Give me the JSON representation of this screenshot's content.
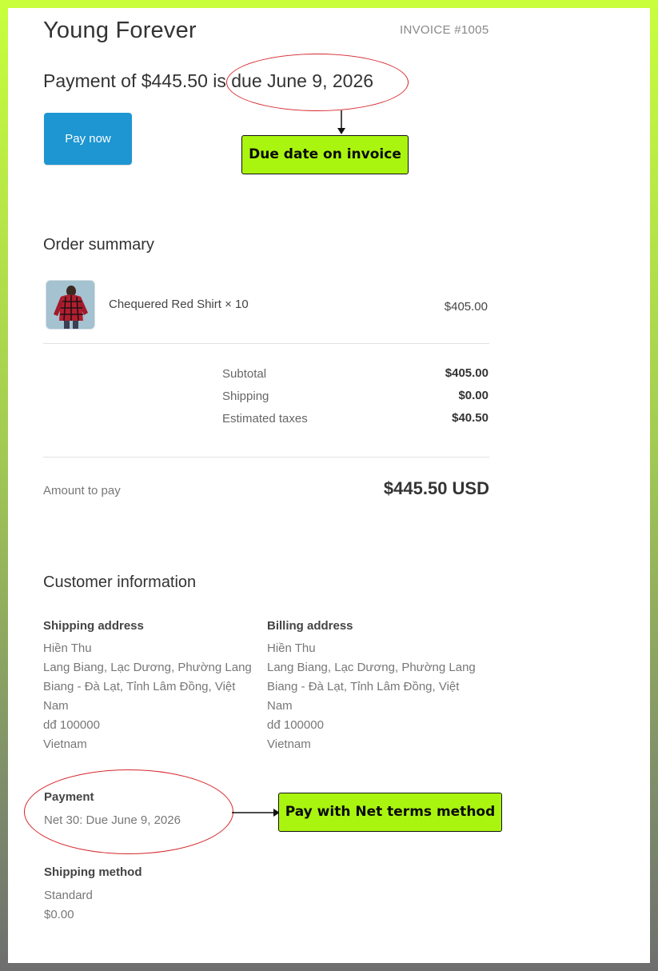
{
  "header": {
    "store_name": "Young Forever",
    "invoice_number": "INVOICE #1005"
  },
  "payment_banner": {
    "prefix": "Payment of $445.50 is ",
    "due_text": "due June 9, 2026",
    "pay_button_label": "Pay now"
  },
  "order_summary": {
    "title": "Order summary",
    "item": {
      "name": "Chequered Red Shirt × 10",
      "price": "$405.00"
    },
    "totals": [
      {
        "label": "Subtotal",
        "value": "$405.00"
      },
      {
        "label": "Shipping",
        "value": "$0.00"
      },
      {
        "label": "Estimated taxes",
        "value": "$40.50"
      }
    ],
    "amount_label": "Amount to pay",
    "amount_value": "$445.50 USD"
  },
  "customer_info": {
    "title": "Customer information",
    "shipping_address": {
      "title": "Shipping address",
      "name": "Hiền Thu",
      "line1": "Lang Biang, Lạc Dương, Phường Lang Biang - Đà Lạt, Tỉnh Lâm Đồng, Việt Nam",
      "postal": "dđ 100000",
      "country": "Vietnam"
    },
    "billing_address": {
      "title": "Billing address",
      "name": "Hiền Thu",
      "line1": "Lang Biang, Lạc Dương, Phường Lang Biang - Đà Lạt, Tỉnh Lâm Đồng, Việt Nam",
      "postal": "dđ 100000",
      "country": "Vietnam"
    },
    "payment": {
      "title": "Payment",
      "value": "Net 30: Due June 9, 2026"
    },
    "shipping_method": {
      "title": "Shipping method",
      "name": "Standard",
      "price": "$0.00"
    }
  },
  "annotations": {
    "due_date_callout": "Due date on invoice",
    "net_terms_callout": "Pay with Net terms method",
    "callout_color": "#a9f50f",
    "circle_color": "#d6262b"
  }
}
